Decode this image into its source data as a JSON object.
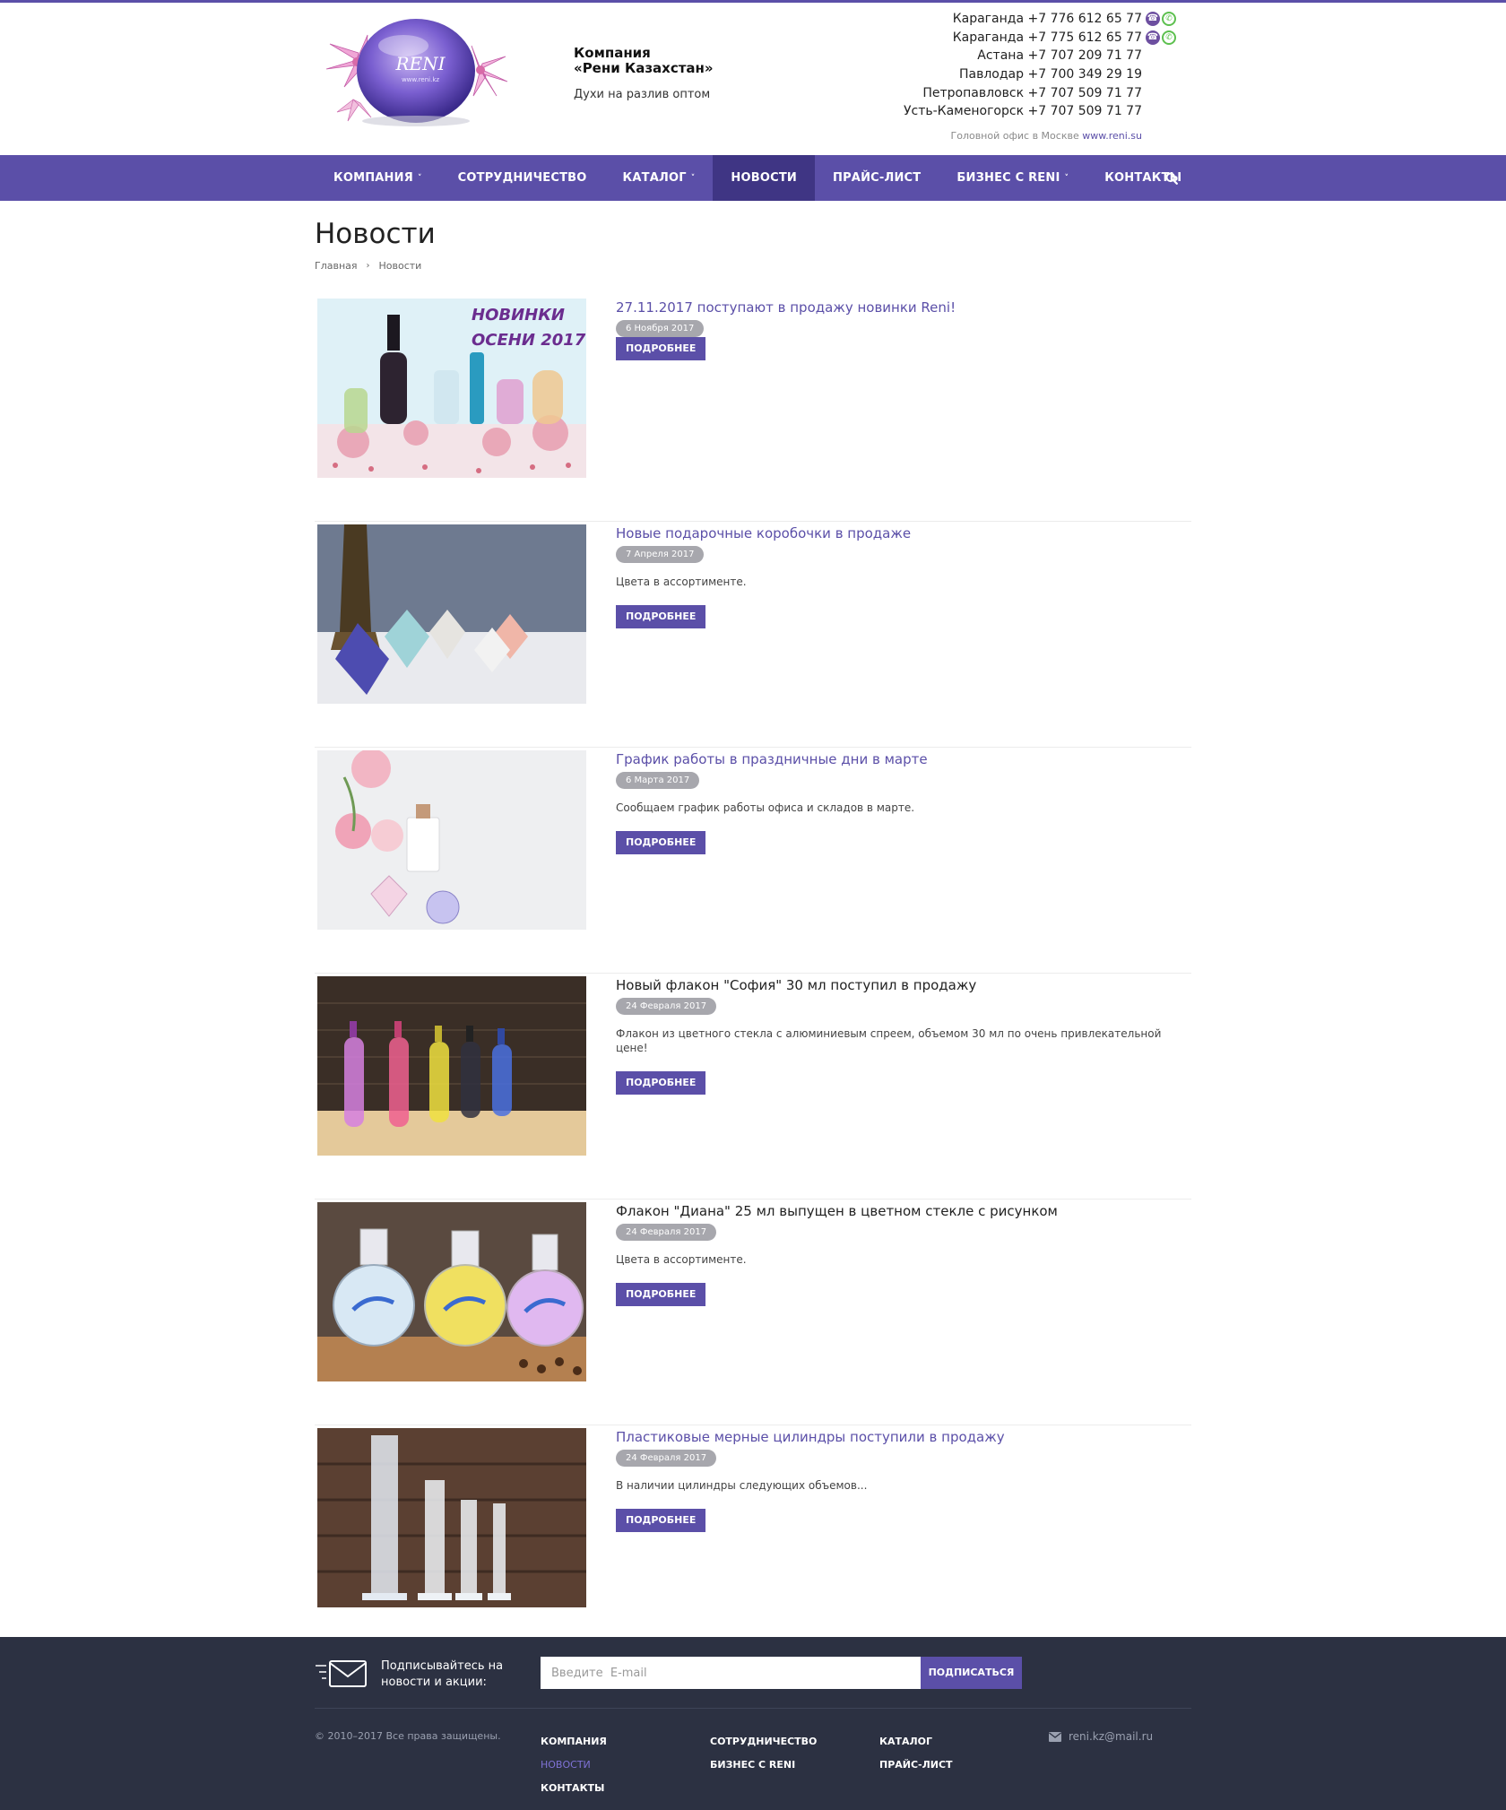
{
  "header": {
    "company_name_line1": "Компания",
    "company_name_line2": "«Рени Казахстан»",
    "tagline": "Духи на разлив оптом",
    "logo_text": "RENI",
    "logo_url_text": "www.reni.kz",
    "phones": [
      {
        "city": "Караганда",
        "number": "+7 776 612 65 77",
        "messengers": [
          "viber-icon",
          "whatsapp-icon"
        ]
      },
      {
        "city": "Караганда",
        "number": "+7 775 612 65 77",
        "messengers": [
          "viber-icon",
          "whatsapp-icon"
        ]
      },
      {
        "city": "Астана",
        "number": "+7 707 209 71 77",
        "messengers": []
      },
      {
        "city": "Павлодар",
        "number": "+7 700 349 29 19",
        "messengers": []
      },
      {
        "city": "Петропавловск",
        "number": "+7 707 509 71 77",
        "messengers": []
      },
      {
        "city": "Усть-Каменогорск",
        "number": "+7 707 509 71 77",
        "messengers": []
      }
    ],
    "office_note": "Головной офис в Москве",
    "office_link": "www.reni.su"
  },
  "nav": {
    "items": [
      {
        "label": "КОМПАНИЯ",
        "dropdown": true,
        "active": false
      },
      {
        "label": "СОТРУДНИЧЕСТВО",
        "dropdown": false,
        "active": false
      },
      {
        "label": "КАТАЛОГ",
        "dropdown": true,
        "active": false
      },
      {
        "label": "НОВОСТИ",
        "dropdown": false,
        "active": true
      },
      {
        "label": "ПРАЙС-ЛИСТ",
        "dropdown": false,
        "active": false
      },
      {
        "label": "БИЗНЕС С RENI",
        "dropdown": true,
        "active": false
      },
      {
        "label": "КОНТАКТЫ",
        "dropdown": false,
        "active": false
      }
    ],
    "search_icon": "search-icon",
    "accent": "#5b4fa8",
    "active_bg": "#3f3584"
  },
  "page": {
    "title": "Новости",
    "breadcrumb": [
      "Главная",
      "Новости"
    ]
  },
  "news": [
    {
      "title": "27.11.2017 поступают в продажу новинки Reni!",
      "date": "6 Ноября 2017",
      "desc": "",
      "more": "ПОДРОБНЕЕ",
      "image_text": "НОВИНКИ ОСЕНИ 2017!"
    },
    {
      "title": "Новые подарочные коробочки в продаже",
      "date": "7 Апреля 2017",
      "desc": "Цвета в ассортименте.",
      "more": "ПОДРОБНЕЕ"
    },
    {
      "title": "График работы в праздничные дни в марте",
      "date": "6 Марта 2017",
      "desc": "Сообщаем график работы офиса и складов в марте.",
      "more": "ПОДРОБНЕЕ"
    },
    {
      "title": "Новый флакон \"София\" 30 мл поступил в продажу",
      "date": "24 Февраля 2017",
      "desc": "Флакон из цветного стекла с алюминиевым спреем, объемом 30 мл по очень привлекательной цене!",
      "more": "ПОДРОБНЕЕ"
    },
    {
      "title": "Флакон \"Диана\" 25 мл выпущен в цветном стекле с рисунком",
      "date": "24 Февраля 2017",
      "desc": "Цвета в ассортименте.",
      "more": "ПОДРОБНЕЕ"
    },
    {
      "title": "Пластиковые мерные цилиндры поступили в продажу",
      "date": "24 Февраля 2017",
      "desc": "В наличии цилиндры следующих объемов...",
      "more": "ПОДРОБНЕЕ"
    }
  ],
  "footer": {
    "subscribe_text": "Подписывайтесь на новости и акции:",
    "email_placeholder": "Введите  E-mail",
    "subscribe_button": "ПОДПИСАТЬСЯ",
    "copyright": "© 2010–2017 Все права защищены.",
    "links": [
      [
        "КОМПАНИЯ",
        "НОВОСТИ",
        "КОНТАКТЫ"
      ],
      [
        "СОТРУДНИЧЕСТВО",
        "БИЗНЕС С RENI"
      ],
      [
        "КАТАЛОГ",
        "ПРАЙС-ЛИСТ"
      ]
    ],
    "active_link": "НОВОСТИ",
    "email": "reni.kz@mail.ru",
    "bg": "#2c3142"
  }
}
